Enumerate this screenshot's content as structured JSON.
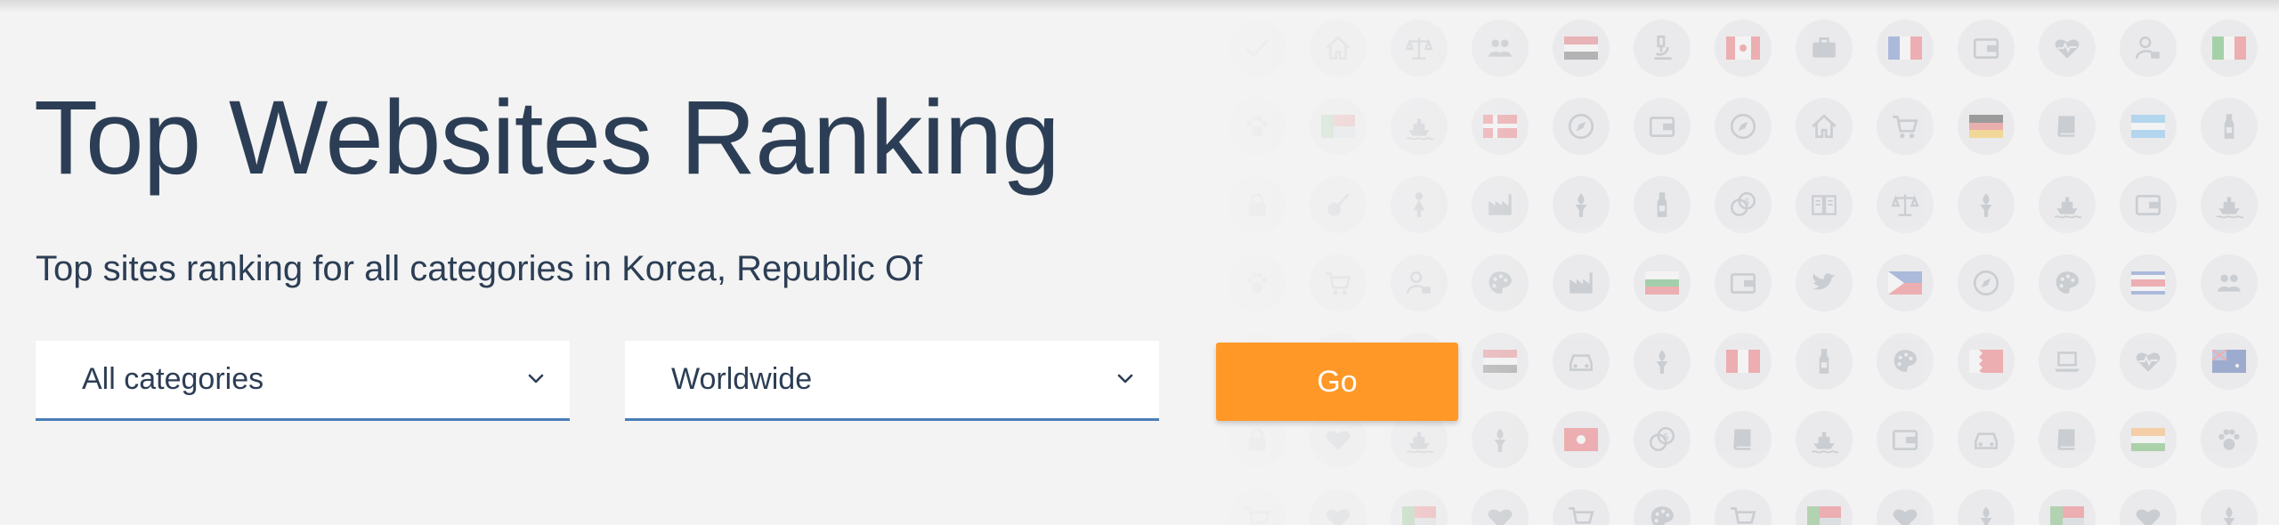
{
  "hero": {
    "title": "Top Websites Ranking",
    "subtitle": "Top sites ranking for all categories in Korea, Republic Of"
  },
  "filters": {
    "category": {
      "selected": "All categories"
    },
    "region": {
      "selected": "Worldwide"
    },
    "go_label": "Go"
  },
  "colors": {
    "background": "#f3f3f3",
    "text": "#2c3e55",
    "accent": "#ff9827",
    "select_underline": "#4a7db5"
  },
  "background_icons": [
    [
      "check-icon",
      "home-icon",
      "scale-icon",
      "users-icon",
      "flag-egypt",
      "microscope-icon",
      "flag-canada",
      "briefcase-icon",
      "flag-france",
      "wallet-icon",
      "heart-pulse-icon",
      "user-lock-icon",
      "flag-italy"
    ],
    [
      "paw-icon",
      "flag-mixed",
      "ship-icon",
      "flag-denmark",
      "compass-icon",
      "wallet-icon",
      "compass-icon",
      "home-icon",
      "cart-icon",
      "flag-germany",
      "book-icon",
      "flag-argentina",
      "bottle-icon"
    ],
    [
      "lock-icon",
      "guitar-icon",
      "person-icon",
      "factory-icon",
      "torch-icon",
      "bottle-icon",
      "coins-icon",
      "book-open-icon",
      "scale-icon",
      "torch-icon",
      "ship-icon",
      "wallet-icon",
      "ship-icon"
    ],
    [
      "paw-icon",
      "cart-icon",
      "user-lock-icon",
      "palette-icon",
      "factory-icon",
      "flag-bulgaria",
      "wallet-icon",
      "twitter-icon",
      "flag-philippines",
      "compass-icon",
      "palette-icon",
      "flag-costa-rica",
      "users-icon"
    ],
    [
      "cart-icon",
      "heart-icon",
      "heart-pulse-icon",
      "flag-egypt",
      "car-icon",
      "torch-icon",
      "flag-peru",
      "bottle-icon",
      "palette-icon",
      "flag-bahrain",
      "laptop-icon",
      "heart-pulse-icon",
      "flag-australia"
    ],
    [
      "lock-icon",
      "heart-icon",
      "ship-icon",
      "torch-icon",
      "flag-hong-kong",
      "coins-icon",
      "book-icon",
      "ship-icon",
      "wallet-icon",
      "car-icon",
      "book-icon",
      "flag-india",
      "paw-icon"
    ],
    [
      "cart-icon",
      "heart-icon",
      "flag-mixed",
      "heart-icon",
      "cart-icon",
      "palette-icon",
      "cart-icon",
      "flag-mixed",
      "heart-icon",
      "torch-icon",
      "flag-mixed",
      "heart-icon",
      "torch-icon"
    ]
  ]
}
